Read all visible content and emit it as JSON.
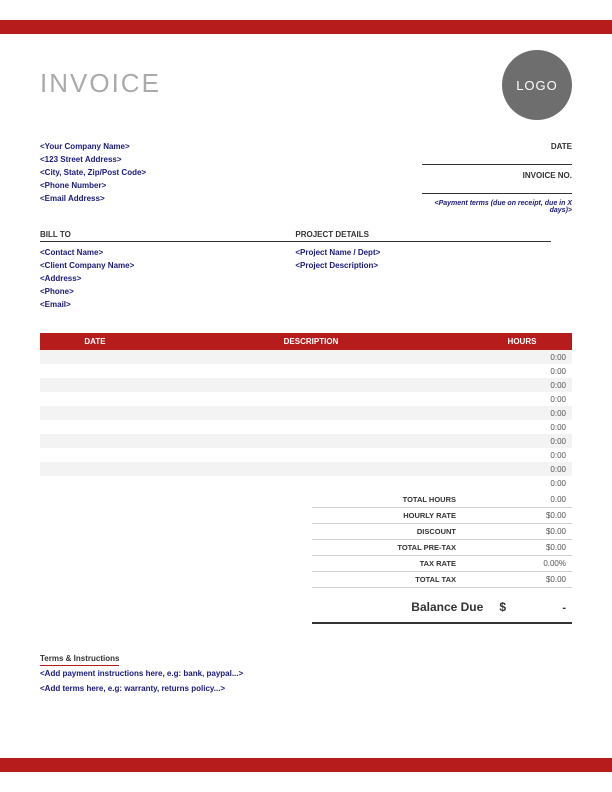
{
  "colors": {
    "accent": "#b71c1c",
    "placeholder": "#1a1a7a"
  },
  "header": {
    "title": "INVOICE",
    "logo_text": "LOGO"
  },
  "company": {
    "name": "<Your Company Name>",
    "address1": "<123 Street Address>",
    "address2": "<City, State, Zip/Post Code>",
    "phone": "<Phone Number>",
    "email": "<Email Address>"
  },
  "meta": {
    "date_label": "DATE",
    "invoice_no_label": "INVOICE NO.",
    "payment_terms": "<Payment terms (due on receipt, due in X days)>"
  },
  "bill_to": {
    "header": "BILL TO",
    "contact": "<Contact Name>",
    "company": "<Client Company Name>",
    "address": "<Address>",
    "phone": "<Phone>",
    "email": "<Email>"
  },
  "project": {
    "header": "PROJECT DETAILS",
    "name": "<Project Name / Dept>",
    "description": "<Project Description>"
  },
  "table": {
    "headers": {
      "date": "DATE",
      "description": "DESCRIPTION",
      "hours": "HOURS"
    },
    "rows": [
      {
        "date": "",
        "description": "",
        "hours": "0:00"
      },
      {
        "date": "",
        "description": "",
        "hours": "0:00"
      },
      {
        "date": "",
        "description": "",
        "hours": "0:00"
      },
      {
        "date": "",
        "description": "",
        "hours": "0:00"
      },
      {
        "date": "",
        "description": "",
        "hours": "0:00"
      },
      {
        "date": "",
        "description": "",
        "hours": "0:00"
      },
      {
        "date": "",
        "description": "",
        "hours": "0:00"
      },
      {
        "date": "",
        "description": "",
        "hours": "0:00"
      },
      {
        "date": "",
        "description": "",
        "hours": "0:00"
      },
      {
        "date": "",
        "description": "",
        "hours": "0:00"
      }
    ]
  },
  "totals": {
    "total_hours": {
      "label": "TOTAL HOURS",
      "value": "0.00"
    },
    "hourly_rate": {
      "label": "HOURLY RATE",
      "value": "$0.00"
    },
    "discount": {
      "label": "DISCOUNT",
      "value": "$0.00"
    },
    "total_pretax": {
      "label": "TOTAL PRE-TAX",
      "value": "$0.00"
    },
    "tax_rate": {
      "label": "TAX RATE",
      "value": "0.00%"
    },
    "total_tax": {
      "label": "TOTAL TAX",
      "value": "$0.00"
    }
  },
  "balance": {
    "label": "Balance Due",
    "currency": "$",
    "value": "-"
  },
  "terms": {
    "header": "Terms & Instructions",
    "payment_instructions": "<Add payment instructions here, e.g: bank, paypal...>",
    "terms_text": "<Add terms here, e.g: warranty, returns policy...>"
  }
}
